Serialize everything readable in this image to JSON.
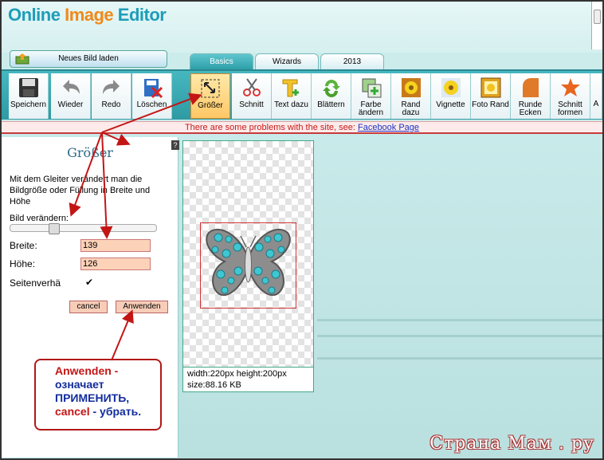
{
  "header": {
    "logo_part1": "Online",
    "logo_part2": "Image",
    "logo_part3": "Editor",
    "load_button": "Neues Bild laden"
  },
  "tabs": [
    {
      "label": "Basics"
    },
    {
      "label": "Wizards"
    },
    {
      "label": "2013"
    }
  ],
  "toolbar": [
    {
      "label": "Speichern",
      "icon": "save-icon"
    },
    {
      "label": "Wieder",
      "icon": "undo-icon"
    },
    {
      "label": "Redo",
      "icon": "redo-icon"
    },
    {
      "label": "Löschen",
      "icon": "delete-icon"
    },
    {
      "label": "Größer",
      "icon": "resize-icon",
      "selected": true
    },
    {
      "label": "Schnitt",
      "icon": "scissors-icon"
    },
    {
      "label": "Text dazu",
      "icon": "text-icon"
    },
    {
      "label": "Blättern",
      "icon": "rotate-icon"
    },
    {
      "label": "Farbe ändern",
      "icon": "color-icon"
    },
    {
      "label": "Rand dazu",
      "icon": "frame-icon"
    },
    {
      "label": "Vignette",
      "icon": "vignette-icon"
    },
    {
      "label": "Foto Rand",
      "icon": "photo-frame-icon"
    },
    {
      "label": "Runde Ecken",
      "icon": "round-corners-icon"
    },
    {
      "label": "Schnitt formen",
      "icon": "shape-cut-icon"
    },
    {
      "label": "A",
      "icon": "more-icon"
    }
  ],
  "notice": {
    "text": "There are some problems with the site, see: ",
    "link": "Facebook Page"
  },
  "panel": {
    "title": "Größer",
    "help": "?",
    "description": "Mit dem Gleiter verändert man die Bildgröße oder Füllung in Breite und Höhe",
    "slider_label": "Bild verändern:",
    "slider_value": 0.28,
    "width_label": "Breite:",
    "width_value": "139",
    "height_label": "Höhe:",
    "height_value": "126",
    "aspect_label": "Seitenverhä",
    "aspect_checked": "✔",
    "cancel": "cancel",
    "apply": "Anwenden"
  },
  "image_info": {
    "line1": "width:220px  height:200px",
    "line2": "size:88.16 KB"
  },
  "annotation": {
    "l1": "Anwenden -",
    "l2": "означает",
    "l3": "ПРИМЕНИТЬ,",
    "l4a": "cancel",
    "l4b": " - убрать."
  },
  "watermark": "Страна Мам . ру",
  "colors": {
    "toolbar": "#3aa9b2",
    "notice_text": "#c71a1a",
    "annotation_border": "#b01818"
  }
}
